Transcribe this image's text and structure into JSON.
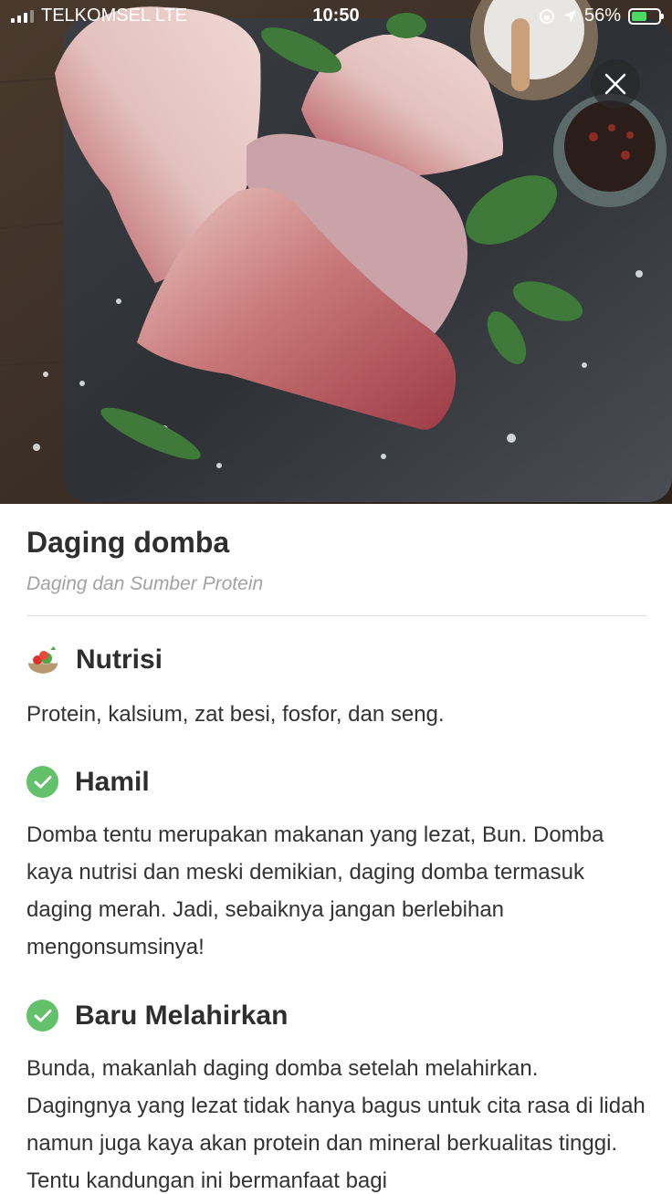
{
  "status_bar": {
    "carrier": "TELKOMSEL LTE",
    "time": "10:50",
    "battery": "56%",
    "battery_level": 0.56
  },
  "hero": {
    "image_icon": "food-photo",
    "close_icon": "close-icon"
  },
  "food": {
    "title": "Daging domba",
    "category": "Daging dan Sumber Protein"
  },
  "sections": [
    {
      "icon": "food-bowl-icon",
      "heading": "Nutrisi",
      "text": "Protein, kalsium, zat besi, fosfor, dan seng."
    },
    {
      "icon": "check-circle-icon",
      "heading": "Hamil",
      "text": "Domba tentu merupakan makanan yang lezat, Bun. Domba kaya nutrisi dan meski demikian, daging domba termasuk daging merah. Jadi, sebaiknya jangan berlebihan mengonsumsinya!"
    },
    {
      "icon": "check-circle-icon",
      "heading": "Baru Melahirkan",
      "text": "Bunda, makanlah daging domba setelah melahirkan. Dagingnya yang lezat tidak hanya bagus untuk cita rasa di lidah namun juga kaya akan protein dan mineral berkualitas tinggi. Tentu kandungan ini bermanfaat bagi"
    }
  ],
  "colors": {
    "check": "#63c06b",
    "muted": "#a3a3a3",
    "text": "#333333"
  }
}
